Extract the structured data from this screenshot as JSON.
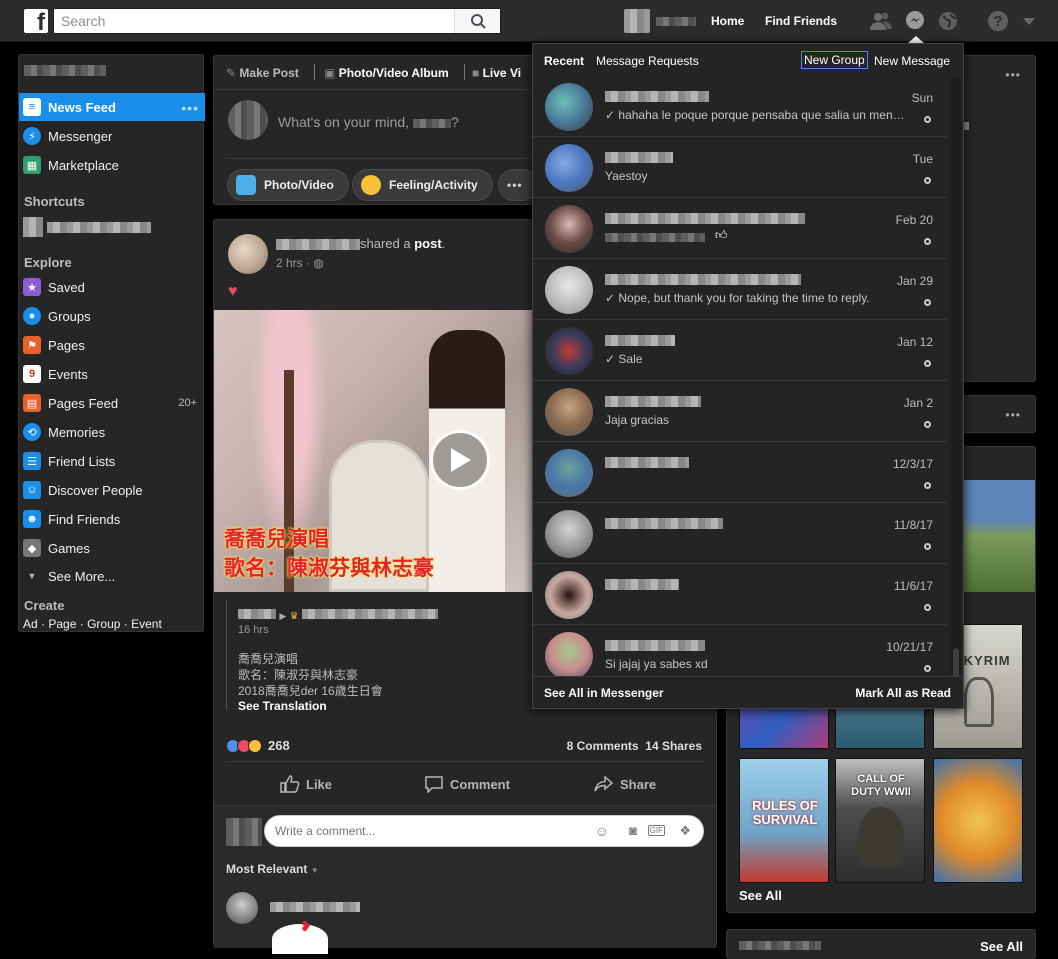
{
  "topbar": {
    "logo_letter": "f",
    "search_placeholder": "Search",
    "nav": [
      "Home",
      "Find Friends"
    ]
  },
  "left_nav": {
    "main": [
      {
        "label": "News Feed",
        "icon": "news-feed-icon",
        "active": true
      },
      {
        "label": "Messenger",
        "icon": "messenger-icon"
      },
      {
        "label": "Marketplace",
        "icon": "marketplace-icon"
      }
    ],
    "shortcuts_title": "Shortcuts",
    "explore_title": "Explore",
    "explore": [
      {
        "label": "Saved",
        "icon": "saved-icon"
      },
      {
        "label": "Groups",
        "icon": "groups-icon"
      },
      {
        "label": "Pages",
        "icon": "pages-icon"
      },
      {
        "label": "Events",
        "icon": "events-icon"
      },
      {
        "label": "Pages Feed",
        "icon": "pages-feed-icon",
        "badge": "20+"
      },
      {
        "label": "Memories",
        "icon": "memories-icon"
      },
      {
        "label": "Friend Lists",
        "icon": "friend-lists-icon"
      },
      {
        "label": "Discover People",
        "icon": "discover-people-icon"
      },
      {
        "label": "Find Friends",
        "icon": "find-friends-icon"
      },
      {
        "label": "Games",
        "icon": "games-icon"
      }
    ],
    "see_more": "See More...",
    "create_title": "Create",
    "create_links": [
      "Ad",
      "Page",
      "Group",
      "Event"
    ]
  },
  "composer": {
    "tabs": [
      "Make Post",
      "Photo/Video Album",
      "Live Vi"
    ],
    "placeholder": "What's on your mind,",
    "placeholder_end": "?",
    "actions": [
      "Photo/Video",
      "Feeling/Activity"
    ]
  },
  "post": {
    "shared_text": "shared a",
    "post_word": "post",
    "time": "2 hrs",
    "video_caption_line1": "喬喬兒演唱",
    "video_caption_line2": "歌名：陳淑芬與林志豪",
    "inner_time": "16 hrs",
    "inner_text": [
      "喬喬兒演唱",
      "歌名：陳淑芬與林志豪",
      "2018喬喬兒der 16歲生日會"
    ],
    "see_translation": "See Translation",
    "reaction_count": "268",
    "comments": "8 Comments",
    "shares": "14 Shares",
    "like": "Like",
    "comment": "Comment",
    "share": "Share",
    "comment_placeholder": "Write a comment...",
    "most_relevant": "Most Relevant"
  },
  "messages": {
    "tab_recent": "Recent",
    "tab_requests": "Message Requests",
    "new_group": "New Group",
    "new_message": "New Message",
    "items": [
      {
        "snippet": "✓ hahaha le poque porque pensaba que salia un men…",
        "date": "Sun"
      },
      {
        "snippet": "Yaestoy",
        "date": "Tue"
      },
      {
        "snippet": "",
        "date": "Feb 20"
      },
      {
        "snippet": "✓ Nope, but thank you for taking the time to reply.",
        "date": "Jan 29"
      },
      {
        "snippet": "✓ Sale",
        "date": "Jan 12"
      },
      {
        "snippet": "Jaja gracias",
        "date": "Jan 2"
      },
      {
        "snippet": "",
        "date": "12/3/17"
      },
      {
        "snippet": "",
        "date": "11/8/17"
      },
      {
        "snippet": "",
        "date": "11/6/17"
      },
      {
        "snippet": "Si jajaj ya sabes xd",
        "date": "10/21/17"
      }
    ],
    "see_all": "See All in Messenger",
    "mark_all": "Mark All as Read"
  },
  "right": {
    "see_all": "See All",
    "see_all_bottom": "See All",
    "games": [
      "RULES OF SURVIVAL",
      "CALL OF DUTY WWII",
      "SKYRIM"
    ]
  },
  "colors": {
    "accent": "#1a8ee8",
    "bg": "#000000",
    "card": "#262626"
  }
}
